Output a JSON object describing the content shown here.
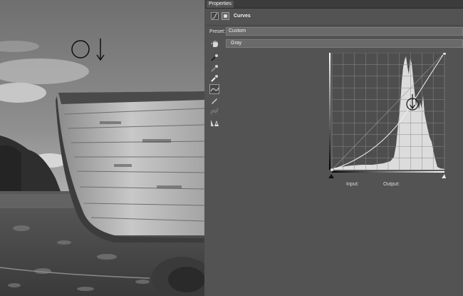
{
  "panel": {
    "tab_label": "Properties",
    "adjustment_title": "Curves",
    "preset_label": "Preset:",
    "preset_value": "Custom",
    "channel_value": "Gray",
    "input_label": "Input:",
    "output_label": "Output:"
  },
  "icons": {
    "curves_adjustment": "curves-adjustment-icon",
    "mask": "layer-mask-icon",
    "on_image": "targeted-adjustment-hand-icon",
    "sample_black": "black-point-eyedropper-icon",
    "sample_gray": "gray-point-eyedropper-icon",
    "sample_white": "white-point-eyedropper-icon",
    "edit_points": "edit-points-curve-icon",
    "draw_curve": "pencil-draw-icon",
    "smooth": "smooth-curve-icon",
    "clipping": "clipping-warning-icon"
  },
  "colors": {
    "panel_bg": "#535353",
    "graph_bg": "#4e4e4e",
    "histogram": "#dcdcdc",
    "curve": "#f2f2f2",
    "field": "#6a6a6a"
  }
}
